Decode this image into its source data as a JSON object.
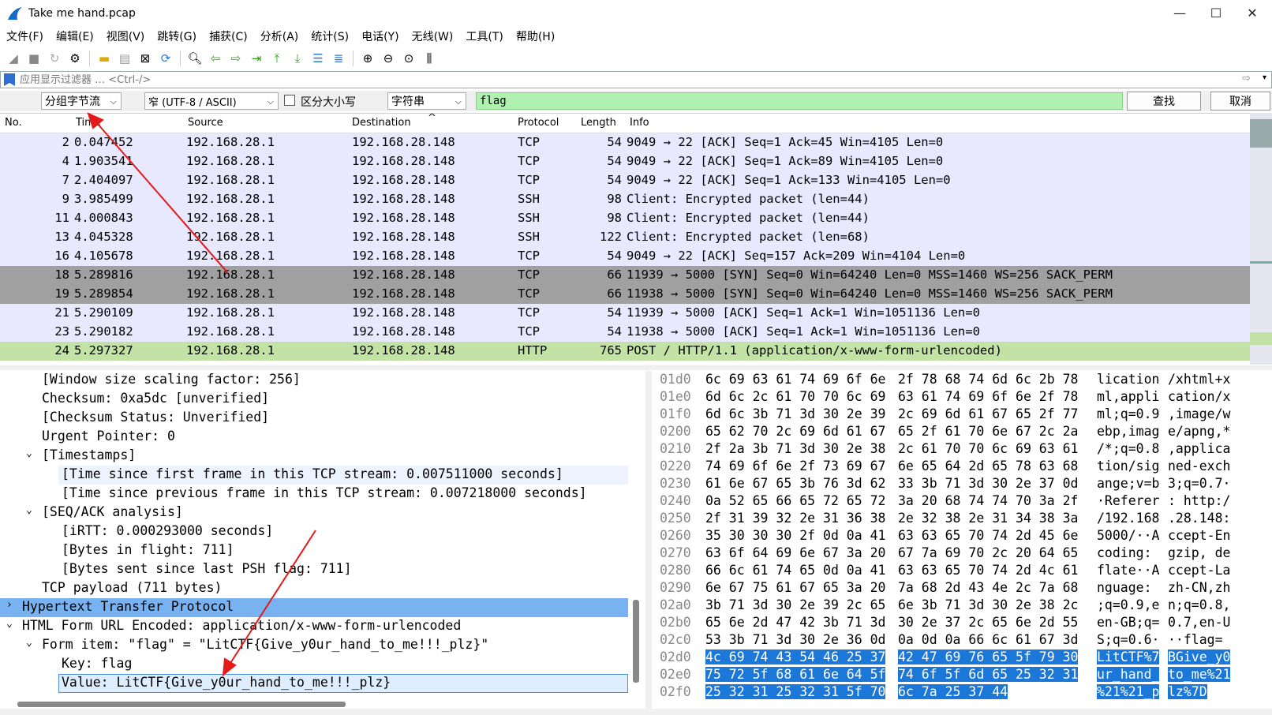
{
  "window": {
    "title": "Take me hand.pcap",
    "minimize": "—",
    "maximize": "☐",
    "close": "✕"
  },
  "menu": [
    "文件(F)",
    "编辑(E)",
    "视图(V)",
    "跳转(G)",
    "捕获(C)",
    "分析(A)",
    "统计(S)",
    "电话(Y)",
    "无线(W)",
    "工具(T)",
    "帮助(H)"
  ],
  "filter": {
    "placeholder": "应用显示过滤器 … <Ctrl-/>"
  },
  "find": {
    "scope": "分组字节流",
    "encoding": "窄 (UTF-8 / ASCII)",
    "case_label": "区分大小写",
    "type": "字符串",
    "query": "flag",
    "find_button": "查找",
    "cancel_button": "取消"
  },
  "columns": [
    "No.",
    "Time",
    "Source",
    "Destination",
    "Protocol",
    "Length",
    "Info"
  ],
  "packets": [
    {
      "no": "2",
      "time": "0.047452",
      "src": "192.168.28.1",
      "dst": "192.168.28.148",
      "proto": "TCP",
      "len": "54",
      "info": "9049 → 22 [ACK] Seq=1 Ack=45 Win=4105 Len=0",
      "bg": "#e8e8ff"
    },
    {
      "no": "4",
      "time": "1.903541",
      "src": "192.168.28.1",
      "dst": "192.168.28.148",
      "proto": "TCP",
      "len": "54",
      "info": "9049 → 22 [ACK] Seq=1 Ack=89 Win=4105 Len=0",
      "bg": "#e8e8ff"
    },
    {
      "no": "7",
      "time": "2.404097",
      "src": "192.168.28.1",
      "dst": "192.168.28.148",
      "proto": "TCP",
      "len": "54",
      "info": "9049 → 22 [ACK] Seq=1 Ack=133 Win=4105 Len=0",
      "bg": "#e8e8ff"
    },
    {
      "no": "9",
      "time": "3.985499",
      "src": "192.168.28.1",
      "dst": "192.168.28.148",
      "proto": "SSH",
      "len": "98",
      "info": "Client: Encrypted packet (len=44)",
      "bg": "#e8e8ff"
    },
    {
      "no": "11",
      "time": "4.000843",
      "src": "192.168.28.1",
      "dst": "192.168.28.148",
      "proto": "SSH",
      "len": "98",
      "info": "Client: Encrypted packet (len=44)",
      "bg": "#e8e8ff"
    },
    {
      "no": "13",
      "time": "4.045328",
      "src": "192.168.28.1",
      "dst": "192.168.28.148",
      "proto": "SSH",
      "len": "122",
      "info": "Client: Encrypted packet (len=68)",
      "bg": "#e8e8ff"
    },
    {
      "no": "16",
      "time": "4.105678",
      "src": "192.168.28.1",
      "dst": "192.168.28.148",
      "proto": "TCP",
      "len": "54",
      "info": "9049 → 22 [ACK] Seq=157 Ack=209 Win=4104 Len=0",
      "bg": "#e8e8ff"
    },
    {
      "no": "18",
      "time": "5.289816",
      "src": "192.168.28.1",
      "dst": "192.168.28.148",
      "proto": "TCP",
      "len": "66",
      "info": "11939 → 5000 [SYN] Seq=0 Win=64240 Len=0 MSS=1460 WS=256 SACK_PERM",
      "bg": "#a0a0a0"
    },
    {
      "no": "19",
      "time": "5.289854",
      "src": "192.168.28.1",
      "dst": "192.168.28.148",
      "proto": "TCP",
      "len": "66",
      "info": "11938 → 5000 [SYN] Seq=0 Win=64240 Len=0 MSS=1460 WS=256 SACK_PERM",
      "bg": "#a0a0a0"
    },
    {
      "no": "21",
      "time": "5.290109",
      "src": "192.168.28.1",
      "dst": "192.168.28.148",
      "proto": "TCP",
      "len": "54",
      "info": "11939 → 5000 [ACK] Seq=1 Ack=1 Win=1051136 Len=0",
      "bg": "#e8e8ff"
    },
    {
      "no": "23",
      "time": "5.290182",
      "src": "192.168.28.1",
      "dst": "192.168.28.148",
      "proto": "TCP",
      "len": "54",
      "info": "11938 → 5000 [ACK] Seq=1 Ack=1 Win=1051136 Len=0",
      "bg": "#e8e8ff"
    },
    {
      "no": "24",
      "time": "5.297327",
      "src": "192.168.28.1",
      "dst": "192.168.28.148",
      "proto": "HTTP",
      "len": "765",
      "info": "POST / HTTP/1.1  (application/x-www-form-urlencoded)",
      "bg": "#c2e3a5"
    }
  ],
  "details": [
    {
      "t": "[Window size scaling factor: 256]",
      "i": 2,
      "e": ""
    },
    {
      "t": "Checksum: 0xa5dc [unverified]",
      "i": 2,
      "e": ""
    },
    {
      "t": "[Checksum Status: Unverified]",
      "i": 2,
      "e": ""
    },
    {
      "t": "Urgent Pointer: 0",
      "i": 2,
      "e": ""
    },
    {
      "t": "[Timestamps]",
      "i": 2,
      "e": "v"
    },
    {
      "t": "[Time since first frame in this TCP stream: 0.007511000 seconds]",
      "i": 3,
      "e": "",
      "bg": "#eef4ff"
    },
    {
      "t": "[Time since previous frame in this TCP stream: 0.007218000 seconds]",
      "i": 3,
      "e": ""
    },
    {
      "t": "[SEQ/ACK analysis]",
      "i": 2,
      "e": "v"
    },
    {
      "t": "[iRTT: 0.000293000 seconds]",
      "i": 3,
      "e": ""
    },
    {
      "t": "[Bytes in flight: 711]",
      "i": 3,
      "e": ""
    },
    {
      "t": "[Bytes sent since last PSH flag: 711]",
      "i": 3,
      "e": ""
    },
    {
      "t": "TCP payload (711 bytes)",
      "i": 2,
      "e": ""
    },
    {
      "t": "Hypertext Transfer Protocol",
      "i": 1,
      "e": ">",
      "bg": "#78b2f0"
    },
    {
      "t": "HTML Form URL Encoded: application/x-www-form-urlencoded",
      "i": 1,
      "e": "v"
    },
    {
      "t": "Form item: \"flag\" = \"LitCTF{Give_y0ur_hand_to_me!!!_plz}\"",
      "i": 2,
      "e": "v"
    },
    {
      "t": "Key: flag",
      "i": 3,
      "e": ""
    },
    {
      "t": "Value: LitCTF{Give_y0ur_hand_to_me!!!_plz}",
      "i": 3,
      "e": "",
      "bg": "#dfeeff",
      "box": true
    }
  ],
  "hex": [
    {
      "o": "01d0",
      "a": "6c 69 63 61 74 69 6f 6e",
      "b": "2f 78 68 74 6d 6c 2b 78",
      "sa": "lication",
      "sb": "/xhtml+x"
    },
    {
      "o": "01e0",
      "a": "6d 6c 2c 61 70 70 6c 69",
      "b": "63 61 74 69 6f 6e 2f 78",
      "sa": "ml,appli",
      "sb": "cation/x"
    },
    {
      "o": "01f0",
      "a": "6d 6c 3b 71 3d 30 2e 39",
      "b": "2c 69 6d 61 67 65 2f 77",
      "sa": "ml;q=0.9",
      ",sb": "",
      "sb": ",image/w"
    },
    {
      "o": "0200",
      "a": "65 62 70 2c 69 6d 61 67",
      "b": "65 2f 61 70 6e 67 2c 2a",
      "sa": "ebp,imag",
      "sb": "e/apng,*"
    },
    {
      "o": "0210",
      "a": "2f 2a 3b 71 3d 30 2e 38",
      "b": "2c 61 70 70 6c 69 63 61",
      "sa": "/*;q=0.8",
      "sb": ",applica"
    },
    {
      "o": "0220",
      "a": "74 69 6f 6e 2f 73 69 67",
      "b": "6e 65 64 2d 65 78 63 68",
      "sa": "tion/sig",
      "sb": "ned-exch"
    },
    {
      "o": "0230",
      "a": "61 6e 67 65 3b 76 3d 62",
      "b": "33 3b 71 3d 30 2e 37 0d",
      "sa": "ange;v=b",
      "sb": "3;q=0.7·"
    },
    {
      "o": "0240",
      "a": "0a 52 65 66 65 72 65 72",
      "b": "3a 20 68 74 74 70 3a 2f",
      "sa": "·Referer",
      "sb": ": http:/"
    },
    {
      "o": "0250",
      "a": "2f 31 39 32 2e 31 36 38",
      "b": "2e 32 38 2e 31 34 38 3a",
      "sa": "/192.168",
      "sb": ".28.148:"
    },
    {
      "o": "0260",
      "a": "35 30 30 30 2f 0d 0a 41",
      "b": "63 63 65 70 74 2d 45 6e",
      "sa": "5000/··A",
      "sb": "ccept-En"
    },
    {
      "o": "0270",
      "a": "63 6f 64 69 6e 67 3a 20",
      "b": "67 7a 69 70 2c 20 64 65",
      "sa": "coding: ",
      "sb": "gzip, de"
    },
    {
      "o": "0280",
      "a": "66 6c 61 74 65 0d 0a 41",
      "b": "63 63 65 70 74 2d 4c 61",
      "sa": "flate··A",
      "sb": "ccept-La"
    },
    {
      "o": "0290",
      "a": "6e 67 75 61 67 65 3a 20",
      "b": "7a 68 2d 43 4e 2c 7a 68",
      "sa": "nguage: ",
      "sb": "zh-CN,zh"
    },
    {
      "o": "02a0",
      "a": "3b 71 3d 30 2e 39 2c 65",
      "b": "6e 3b 71 3d 30 2e 38 2c",
      "sa": ";q=0.9,e",
      "sb": "n;q=0.8,"
    },
    {
      "o": "02b0",
      "a": "65 6e 2d 47 42 3b 71 3d",
      "b": "30 2e 37 2c 65 6e 2d 55",
      "sa": "en-GB;q=",
      "sb": "0.7,en-U"
    },
    {
      "o": "02c0",
      "a": "53 3b 71 3d 30 2e 36 0d",
      "b": "0a 0d 0a 66 6c 61 67 3d",
      "sa": "S;q=0.6·",
      "sb": "··flag="
    },
    {
      "o": "02d0",
      "a": "4c 69 74 43 54 46 25 37",
      "b": "42 47 69 76 65 5f 79 30",
      "sa": "LitCTF%7",
      "sb": "BGive_y0",
      "hl": true
    },
    {
      "o": "02e0",
      "a": "75 72 5f 68 61 6e 64 5f",
      "b": "74 6f 5f 6d 65 25 32 31",
      "sa": "ur_hand_",
      "sb": "to_me%21",
      "hl": true
    },
    {
      "o": "02f0",
      "a": "25 32 31 25 32 31 5f 70",
      "b": "6c 7a 25 37 44",
      "sa": "%21%21_p",
      "sb": "lz%7D",
      "hl": true
    }
  ]
}
